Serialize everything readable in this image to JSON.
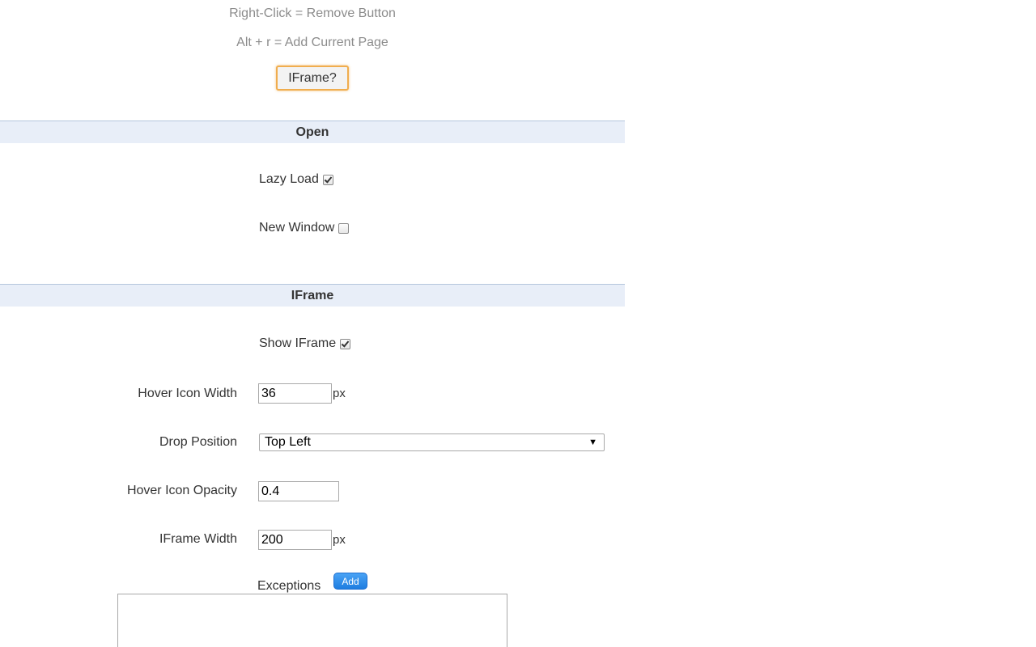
{
  "hints": {
    "right_click": "Right-Click = Remove Button",
    "alt_r": "Alt + r = Add Current Page"
  },
  "iframe_help_button": "IFrame?",
  "sections": {
    "open": {
      "title": "Open",
      "lazy_load": {
        "label": "Lazy Load",
        "checked": true
      },
      "new_window": {
        "label": "New Window",
        "checked": false
      }
    },
    "iframe": {
      "title": "IFrame",
      "show_iframe": {
        "label": "Show IFrame",
        "checked": true
      },
      "hover_icon_width": {
        "label": "Hover Icon Width",
        "value": "36",
        "unit": "px"
      },
      "drop_position": {
        "label": "Drop Position",
        "selected": "Top Left"
      },
      "hover_icon_opacity": {
        "label": "Hover Icon Opacity",
        "value": "0.4"
      },
      "iframe_width": {
        "label": "IFrame Width",
        "value": "200",
        "unit": "px"
      },
      "exceptions": {
        "label": "Exceptions",
        "add_label": "Add",
        "value": ""
      }
    }
  },
  "colors": {
    "section_header_bg": "#e8eef8",
    "highlight_border": "#f0ad4e",
    "add_button": "#1e7de0"
  }
}
